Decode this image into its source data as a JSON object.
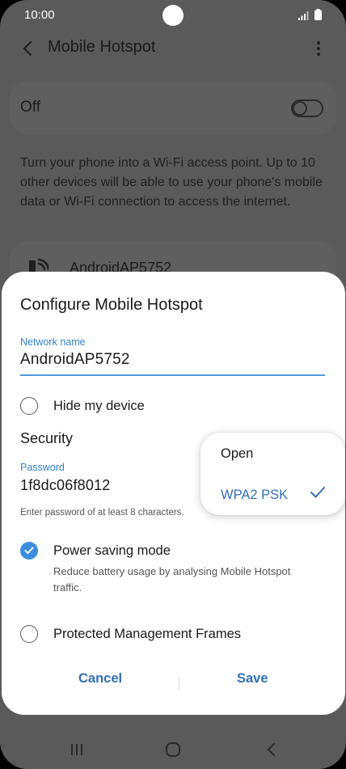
{
  "status_bar": {
    "time": "10:00",
    "icons": [
      "signal-icon",
      "battery-icon"
    ]
  },
  "app_bar": {
    "title": "Mobile Hotspot",
    "back_icon": "chevron-left-icon",
    "more_icon": "more-vertical-icon"
  },
  "background": {
    "master_switch_label": "Off",
    "master_switch_state": "off",
    "description": "Turn your phone into a Wi-Fi access point. Up to 10 other devices will be able to use your phone's mobile data or Wi-Fi connection to access the internet.",
    "network_card_name": "AndroidAP5752"
  },
  "dialog": {
    "title": "Configure Mobile Hotspot",
    "network_name_label": "Network name",
    "network_name_value": "AndroidAP5752",
    "hide_device_label": "Hide my device",
    "hide_device_checked": false,
    "security_label": "Security",
    "password_label": "Password",
    "password_value": "1f8dc06f8012",
    "password_hint": "Enter password of at least 8 characters.",
    "power_saving_label": "Power saving mode",
    "power_saving_checked": true,
    "power_saving_desc": "Reduce battery usage by analysing Mobile Hotspot traffic.",
    "pmf_label": "Protected Management Frames",
    "pmf_checked": false,
    "cancel_label": "Cancel",
    "save_label": "Save"
  },
  "security_menu": {
    "options": [
      "Open",
      "WPA2 PSK"
    ],
    "selected": "WPA2 PSK"
  },
  "colors": {
    "accent": "#3b8de0",
    "button_text": "#2f6fc0",
    "scrim_bg": "#5a5a5a"
  },
  "nav_bar": {
    "icons": [
      "recent-apps-icon",
      "home-icon",
      "back-icon"
    ]
  }
}
